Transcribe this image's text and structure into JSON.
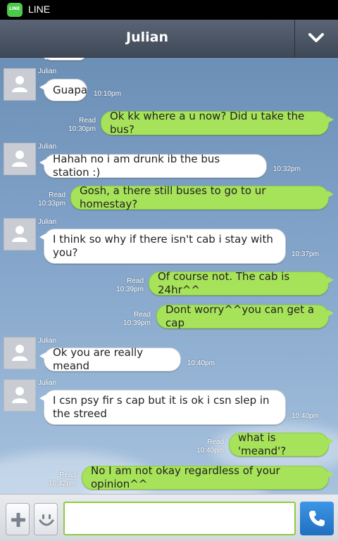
{
  "statusbar": {
    "app_label": "LINE",
    "app_icon": "line-app-icon",
    "app_icon_text": "LINE"
  },
  "header": {
    "title": "Julian",
    "menu_icon": "chevron-down-icon"
  },
  "colors": {
    "outgoing_bubble": "#a7e35a",
    "incoming_bubble": "#ffffff",
    "header": "#4a5364",
    "call_button": "#2d83d6"
  },
  "messages": [
    {
      "direction": "in",
      "sender": "Julian",
      "text": "Guapa",
      "time": "10:10pm"
    },
    {
      "direction": "out",
      "status": "Read",
      "text": "Ok kk where a u now? Did u take the bus?",
      "time": "10:30pm"
    },
    {
      "direction": "in",
      "sender": "Julian",
      "text": "Hahah no i am drunk ib the bus station :)",
      "time": "10:32pm"
    },
    {
      "direction": "out",
      "status": "Read",
      "text": "Gosh, a there still buses to go to ur homestay?",
      "time": "10:33pm"
    },
    {
      "direction": "in",
      "sender": "Julian",
      "text": "I think so why if there isn't cab i stay with you?",
      "time": "10:37pm"
    },
    {
      "direction": "out",
      "status": "Read",
      "text": "Of course not. The cab is 24hr^^",
      "time": "10:39pm"
    },
    {
      "direction": "out",
      "status": "Read",
      "text": "Dont worry^^you can get a cap",
      "time": "10:39pm"
    },
    {
      "direction": "in",
      "sender": "Julian",
      "text": "Ok you are really meand",
      "time": "10:40pm"
    },
    {
      "direction": "in",
      "sender": "Julian",
      "text": "I csn psy fir s cap but it is ok i csn slep in the streed",
      "time": "10:40pm"
    },
    {
      "direction": "out",
      "status": "Read",
      "text": "what is 'meand'?",
      "time": "10:40pm"
    },
    {
      "direction": "out",
      "status": "Read",
      "text": "No I am not okay regardless of your opinion^^",
      "time": "10:42pm"
    }
  ],
  "composer": {
    "plus_icon": "plus-icon",
    "emoji_icon": "smiley-icon",
    "input_value": "",
    "call_icon": "phone-icon"
  }
}
